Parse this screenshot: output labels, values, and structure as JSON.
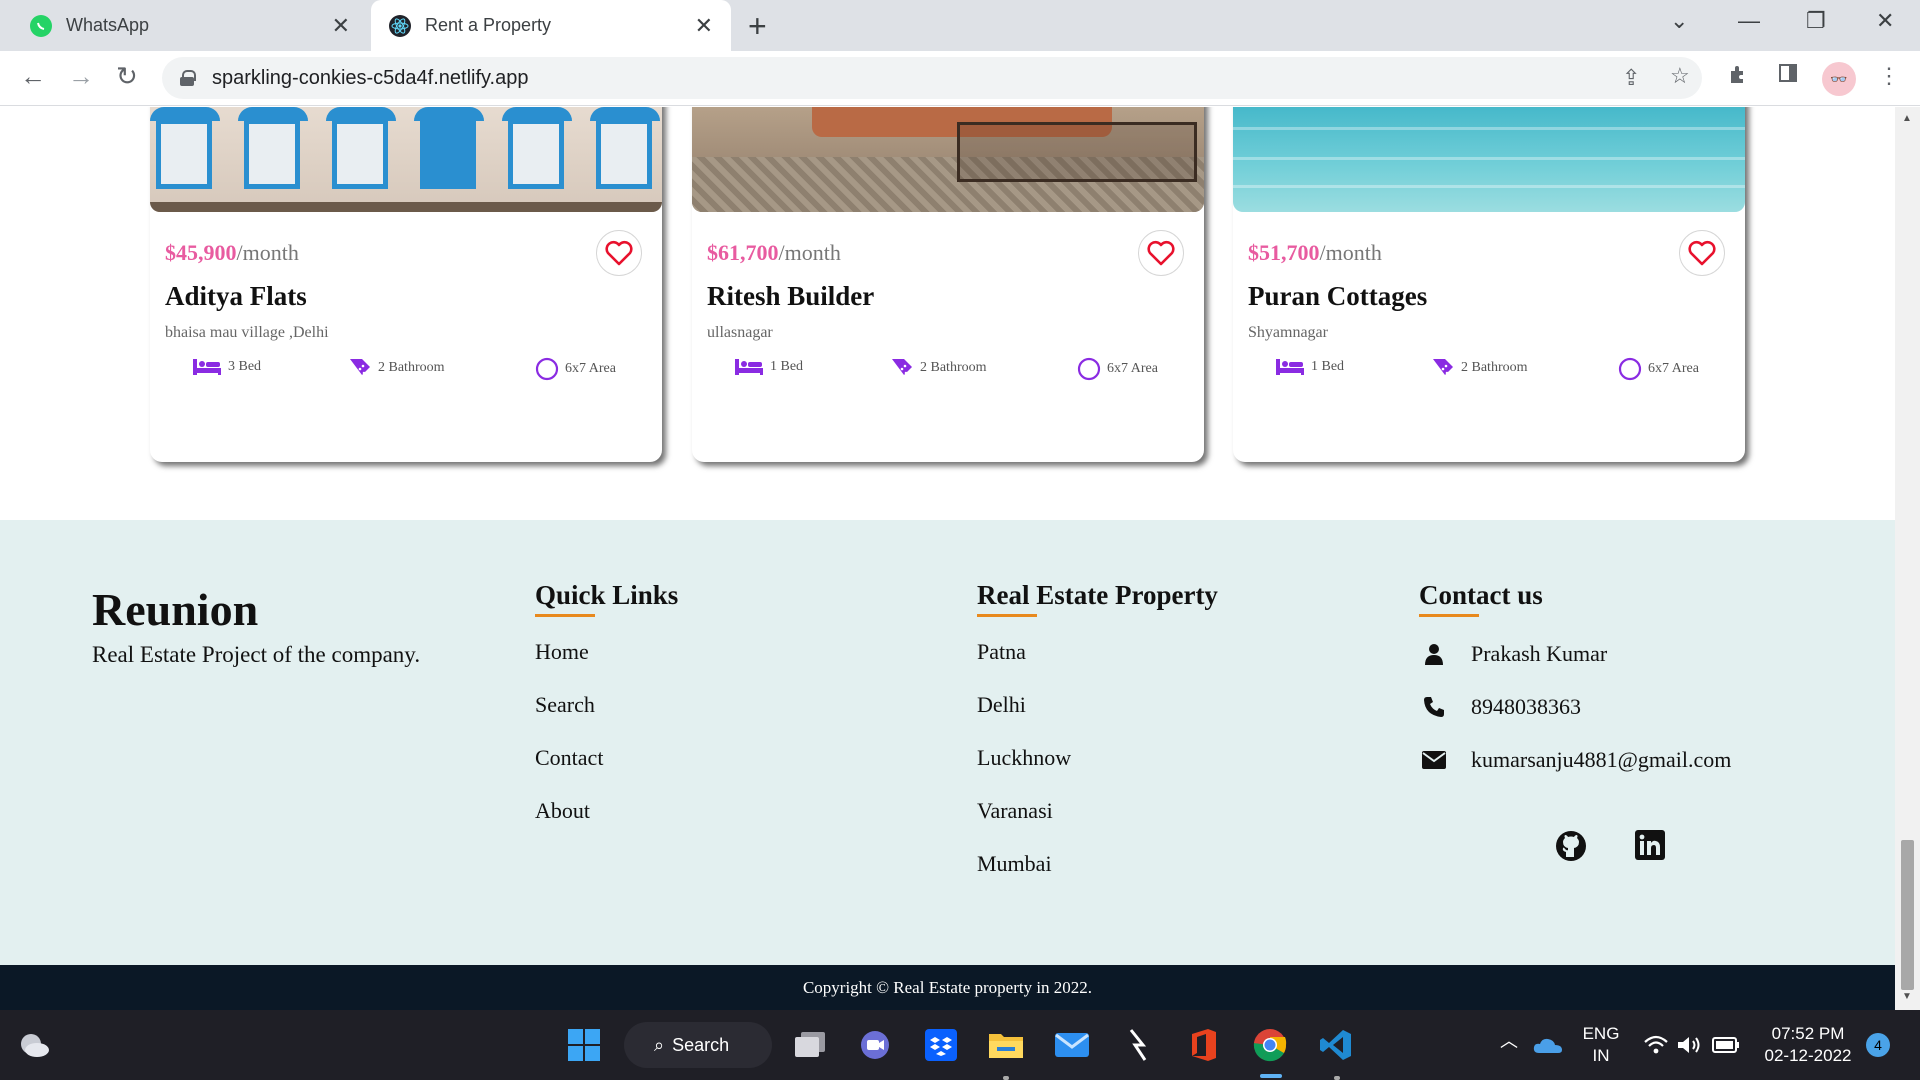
{
  "browser": {
    "tabs": [
      {
        "title": "WhatsApp",
        "icon": "whatsapp-icon"
      },
      {
        "title": "Rent a Property",
        "icon": "react-icon",
        "active": true
      }
    ],
    "url": "sparkling-conkies-c5da4f.netlify.app"
  },
  "cards": [
    {
      "price": "$45,900",
      "per": "/month",
      "name": "Aditya Flats",
      "address": "bhaisa mau village ,Delhi",
      "bed": "3 Bed",
      "bath": "2 Bathroom",
      "area": "6x7 Area"
    },
    {
      "price": "$61,700",
      "per": "/month",
      "name": "Ritesh Builder",
      "address": "ullasnagar",
      "bed": "1 Bed",
      "bath": "2 Bathroom",
      "area": "6x7 Area"
    },
    {
      "price": "$51,700",
      "per": "/month",
      "name": "Puran Cottages",
      "address": "Shyamnagar",
      "bed": "1 Bed",
      "bath": "2 Bathroom",
      "area": "6x7 Area"
    }
  ],
  "footer": {
    "brand": "Reunion",
    "tagline": "Real Estate Project of the company.",
    "quick_links": {
      "title": "Quick Links",
      "items": [
        "Home",
        "Search",
        "Contact",
        "About"
      ]
    },
    "property": {
      "title": "Real Estate Property",
      "items": [
        "Patna",
        "Delhi",
        "Luckhnow",
        "Varanasi",
        "Mumbai"
      ]
    },
    "contact": {
      "title": "Contact us",
      "name": "Prakash Kumar",
      "phone": "8948038363",
      "email": "kumarsanju4881@gmail.com"
    },
    "copyright": "Copyright © Real Estate property in 2022."
  },
  "colors": {
    "price": "#e85ba0",
    "accent_underline": "#e8891d",
    "feature_icon": "#8a2be2",
    "footer_bg": "#e3f0f0",
    "copyright_bg": "#0b1826"
  },
  "taskbar": {
    "search_label": "Search",
    "lang_1": "ENG",
    "lang_2": "IN",
    "time": "07:52 PM",
    "date": "02-12-2022",
    "notifications": "4"
  }
}
